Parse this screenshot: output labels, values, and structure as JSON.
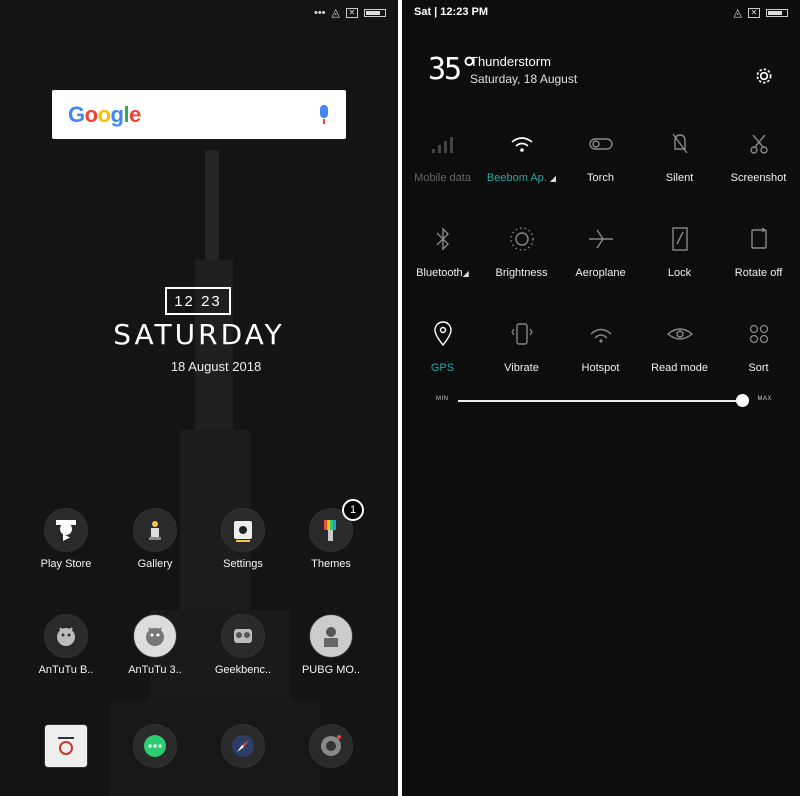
{
  "home": {
    "status_dots": "•••",
    "search": {
      "logo_text": "Google"
    },
    "clock": {
      "time": "12 23",
      "day": "SATURDAY",
      "date": "18 August 2018"
    },
    "apps": [
      {
        "label": "Play Store"
      },
      {
        "label": "Gallery"
      },
      {
        "label": "Settings"
      },
      {
        "label": "Themes",
        "badge": "1"
      },
      {
        "label": "AnTuTu B.."
      },
      {
        "label": "AnTuTu 3.."
      },
      {
        "label": "Geekbenc.."
      },
      {
        "label": "PUBG MO.."
      }
    ]
  },
  "quick_settings": {
    "status": {
      "time": "Sat | 12:23 PM"
    },
    "weather": {
      "temperature": "35°",
      "condition": "Thunderstorm",
      "date": "Saturday, 18 August"
    },
    "tiles": [
      {
        "label": "Mobile data",
        "icon": "signal-icon",
        "state": "off"
      },
      {
        "label": "Beebom Ap.",
        "icon": "wifi-icon",
        "state": "on"
      },
      {
        "label": "Torch",
        "icon": "torch-icon",
        "state": "normal"
      },
      {
        "label": "Silent",
        "icon": "silent-icon",
        "state": "normal"
      },
      {
        "label": "Screenshot",
        "icon": "scissors-icon",
        "state": "normal"
      },
      {
        "label": "Bluetooth",
        "icon": "bluetooth-icon",
        "state": "normal"
      },
      {
        "label": "Brightness",
        "icon": "brightness-icon",
        "state": "normal"
      },
      {
        "label": "Aeroplane",
        "icon": "aeroplane-icon",
        "state": "normal"
      },
      {
        "label": "Lock",
        "icon": "lock-icon",
        "state": "normal"
      },
      {
        "label": "Rotate off",
        "icon": "rotate-icon",
        "state": "normal"
      },
      {
        "label": "GPS",
        "icon": "gps-icon",
        "state": "on"
      },
      {
        "label": "Vibrate",
        "icon": "vibrate-icon",
        "state": "normal"
      },
      {
        "label": "Hotspot",
        "icon": "hotspot-icon",
        "state": "normal"
      },
      {
        "label": "Read mode",
        "icon": "eye-icon",
        "state": "normal"
      },
      {
        "label": "Sort",
        "icon": "grid-icon",
        "state": "normal"
      }
    ],
    "brightness": {
      "min_label": "MIN",
      "max_label": "MAX",
      "level": 1.0
    },
    "colors": {
      "accent": "#2aa7a0"
    }
  }
}
